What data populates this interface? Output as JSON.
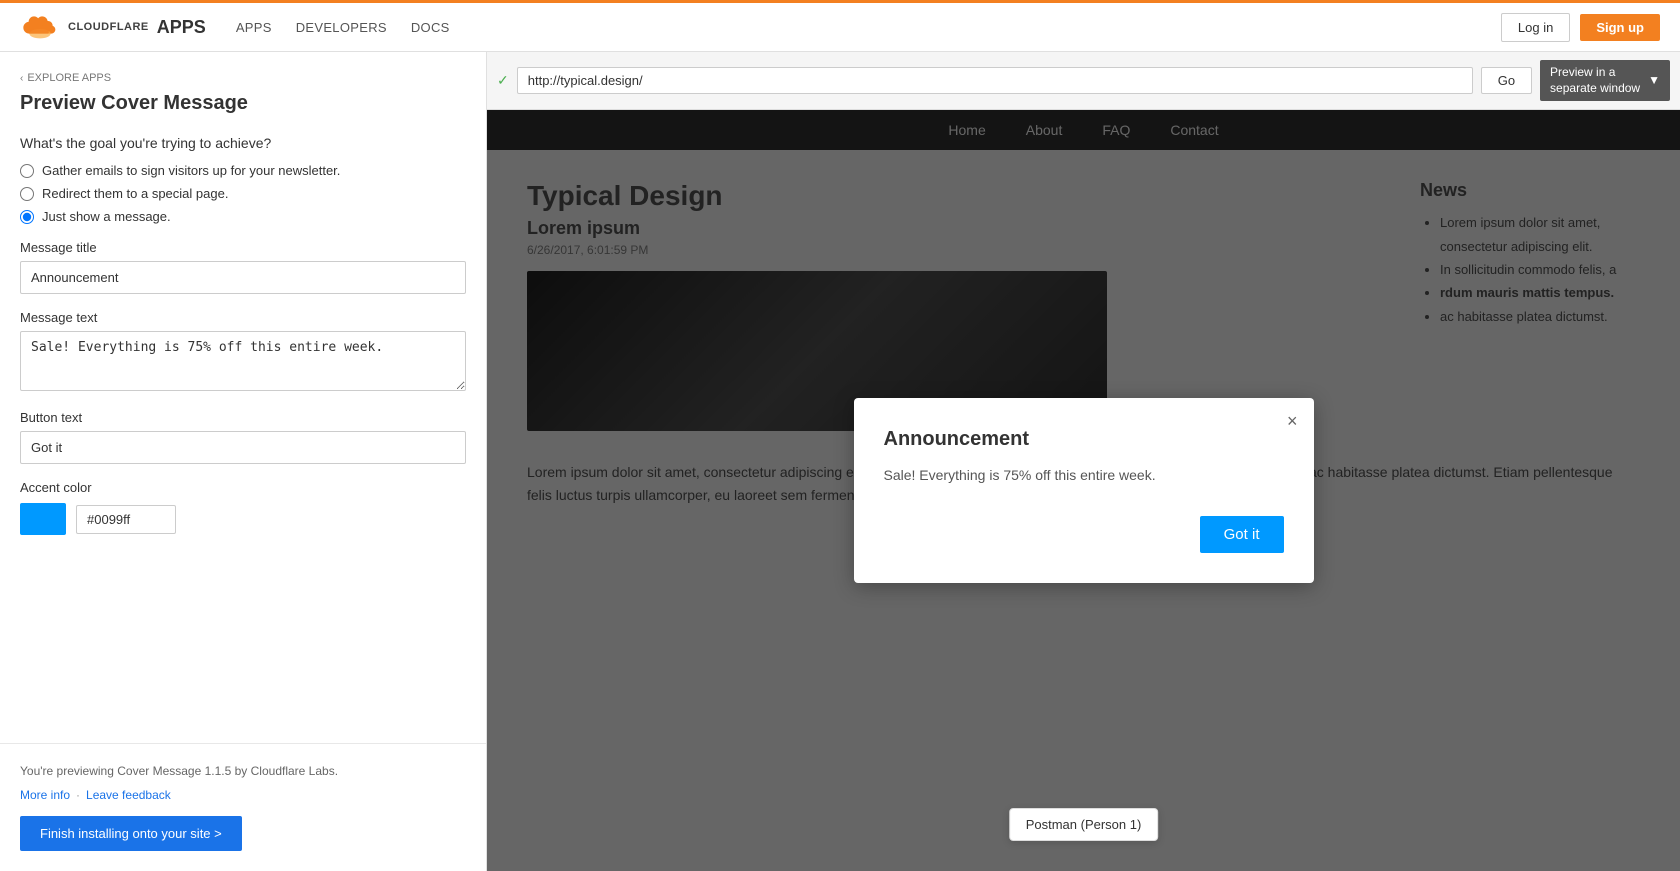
{
  "topnav": {
    "logo_text": "CLOUDFLARE",
    "apps_label": "APPS",
    "nav_links": [
      "APPS",
      "DEVELOPERS",
      "DOCS"
    ],
    "login_label": "Log in",
    "signup_label": "Sign up"
  },
  "left_panel": {
    "explore_apps_label": "EXPLORE APPS",
    "preview_label": "Preview",
    "app_name": "Cover Message",
    "goal_question": "What's the goal you're trying to achieve?",
    "radio_options": [
      "Gather emails to sign visitors up for your newsletter.",
      "Redirect them to a special page.",
      "Just show a message."
    ],
    "selected_radio_index": 2,
    "message_title_label": "Message title",
    "message_title_value": "Announcement",
    "message_text_label": "Message text",
    "message_text_value": "Sale! Everything is 75% off this entire week.",
    "button_text_label": "Button text",
    "button_text_value": "Got it",
    "accent_color_label": "Accent color",
    "accent_color_hex": "#0099ff",
    "preview_note": "You're previewing Cover Message 1.1.5 by Cloudflare Labs.",
    "more_info_label": "More info",
    "leave_feedback_label": "Leave feedback",
    "finish_btn_label": "Finish installing onto your site >"
  },
  "browser_bar": {
    "url": "http://typical.design/",
    "go_label": "Go",
    "preview_window_label": "Preview in a\nseparate window",
    "preview_icon": "▼"
  },
  "website": {
    "nav_links": [
      "Home",
      "About",
      "FAQ",
      "Contact"
    ],
    "site_title": "Typical Design",
    "post_title": "Lorem ipsum",
    "post_date": "6/26/2017, 6:01:59 PM",
    "sidebar_title": "News",
    "sidebar_items": [
      "Lorem ipsum dolor sit amet, consectetur adipiscing elit.",
      "In sollicitudin commodo felis, a",
      "rdum mauris mattis tempus.",
      "ac habitasse platea dictumst."
    ],
    "body_text": "Lorem ipsum dolor sit amet, consectetur adipiscing elit. Proin sollicitudin commodo felis, a interdum mauris mattis tempus. In hac habitasse platea dictumst. Etiam pellentesque felis luctus turpis ullamcorper, eu laoreet sem fermentum. Nulla am congue, nulla ut congue"
  },
  "modal": {
    "title": "Announcement",
    "text": "Sale! Everything is 75% off this entire week.",
    "button_label": "Got it",
    "close_icon": "×"
  },
  "tooltip": {
    "text": "Postman (Person 1)"
  }
}
